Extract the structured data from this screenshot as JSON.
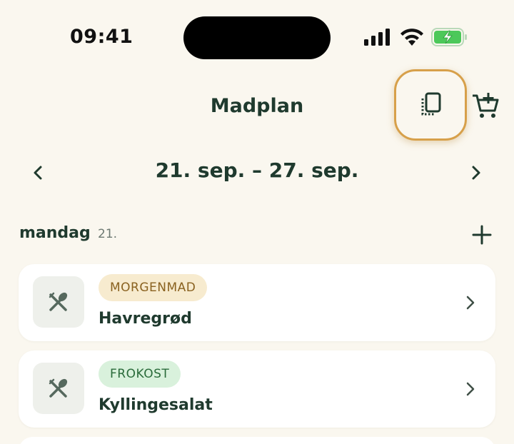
{
  "status_bar": {
    "time": "09:41"
  },
  "header": {
    "title": "Madplan"
  },
  "week": {
    "label": "21. sep. – 27. sep."
  },
  "day": {
    "name": "mandag",
    "date": "21."
  },
  "meals": [
    {
      "type_label": "MORGENMAD",
      "name": "Havregrød"
    },
    {
      "type_label": "FROKOST",
      "name": "Kyllingesalat"
    }
  ],
  "colors": {
    "background": "#FAF7EF",
    "text_primary": "#1F3A2E",
    "highlight_ring": "#D7A04A",
    "battery_green": "#4CC85A",
    "breakfast_badge_bg": "#F7EBCF",
    "lunch_badge_bg": "#D9F1DC"
  }
}
